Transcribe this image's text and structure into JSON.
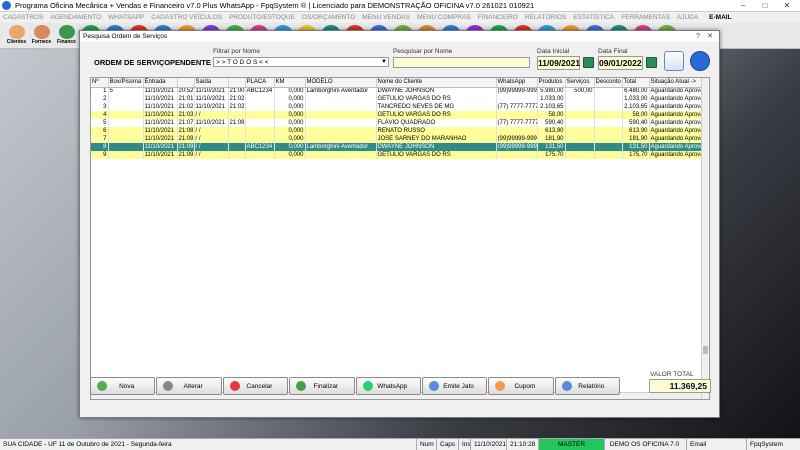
{
  "app": {
    "title": "Programa Oficina Mecânica + Vendas e Financeiro v7.0 Plus WhatsApp - FpqSystem ® | Licenciado para  DEMONSTRAÇÃO OFICINA v7.0 261021 010921"
  },
  "menu": [
    "CADASTROS",
    "AGENDAMENTO",
    "WHATSAPP",
    "CADASTRO VEÍCULOS",
    "PRODUTO/ESTOQUE",
    "OS/ORÇAMENTO",
    "MENU VENDAS",
    "MENU COMPRAS",
    "FINANCEIRO",
    "RELATÓRIOS",
    "ESTATÍSTICA",
    "FERRAMENTAS",
    "AJUDA"
  ],
  "menu_email": "E-MAIL",
  "toolbar": {
    "clientes": "Clientes",
    "fornecedores": "Fornece",
    "financeiro": "Finance"
  },
  "dialog": {
    "title": "Pesquisa Ordem de Serviços",
    "os_label": "ORDEM DE SERVIÇO",
    "status": "PENDENTE",
    "filter_label": "Filtrar por Nome",
    "filter_value": "> > T O D O S < <",
    "search_label": "Pesquisar por Nome",
    "search_value": "",
    "date_start_label": "Data Inicial",
    "date_start": "11/09/2021",
    "date_end_label": "Data Final",
    "date_end": "09/01/2022"
  },
  "table": {
    "headers": [
      "Nº",
      "Box/Pissma",
      "Entrada",
      "",
      "Saída",
      "",
      "PLACA",
      "KM",
      "MODELO",
      "Nome do Cliente",
      "WhatsApp",
      "Produtos",
      "Serviços",
      "Desconto",
      "Total",
      "Situação Atual ->"
    ],
    "rows": [
      {
        "style": "white",
        "cells": [
          "1",
          "5",
          "11/10/2021",
          "20:52",
          "11/10/2021",
          "21:00",
          "ABC1234",
          "0,000",
          "Lamborghini Aventador",
          "DWAYNE JOHNSON",
          "(99)99999-9999",
          "5.980,00",
          "500,00",
          "",
          "6.480,00",
          "Aguardando Aprovaç"
        ]
      },
      {
        "style": "white",
        "cells": [
          "2",
          "",
          "11/10/2021",
          "21:01",
          "11/10/2021",
          "21:02",
          "",
          "0,000",
          "",
          "GETULIO VARGAS DO RS",
          "",
          "1.033,00",
          "",
          "",
          "1.033,00",
          "Aguardando Aprovaç"
        ]
      },
      {
        "style": "white",
        "cells": [
          "3",
          "",
          "11/10/2021",
          "21:02",
          "11/10/2021",
          "21:02",
          "",
          "0,000",
          "",
          "TANCREDO NEVES DE MG",
          "(77) 7777-7777",
          "2.103,65",
          "",
          "",
          "2.103,65",
          "Aguardando Aprovaç"
        ]
      },
      {
        "style": "yellow",
        "cells": [
          "4",
          "",
          "11/10/2021",
          "21:03",
          "/  /",
          "",
          "",
          "0,000",
          "",
          "GETULIO VARGAS DO RS",
          "",
          "58,00",
          "",
          "",
          "58,00",
          "Aguardando Aprovaç"
        ]
      },
      {
        "style": "white",
        "cells": [
          "5",
          "",
          "11/10/2021",
          "21:07",
          "11/10/2021",
          "21:08",
          "",
          "0,000",
          "",
          "FLÁVIO QUADRADO",
          "(77) 7777-7777",
          "590,40",
          "",
          "",
          "590,40",
          "Aguardando Aprovaç"
        ]
      },
      {
        "style": "yellow",
        "cells": [
          "6",
          "",
          "11/10/2021",
          "21:08",
          "/  /",
          "",
          "",
          "0,000",
          "",
          "RENATO RUSSO",
          "",
          "613,90",
          "",
          "",
          "613,90",
          "Aguardando Aprovaç"
        ]
      },
      {
        "style": "yellow",
        "cells": [
          "7",
          "",
          "11/10/2021",
          "21:09",
          "/  /",
          "",
          "",
          "0,000",
          "",
          "JOSÉ SARNEY DO MARANHÃO",
          "(99)99999-9999",
          "181,90",
          "",
          "",
          "181,90",
          "Aguardando Aprovaç"
        ]
      },
      {
        "style": "sel",
        "cells": [
          "8",
          "",
          "11/10/2021",
          "21:09",
          "/  /",
          "",
          "ABC1234",
          "0,000",
          "Lamborghini Aventador",
          "DWAYNE JOHNSON",
          "(99)99999-9999",
          "131,50",
          "",
          "",
          "131,50",
          "Aguardando Aprovaç"
        ]
      },
      {
        "style": "yellow",
        "cells": [
          "9",
          "",
          "11/10/2021",
          "21:09",
          "/  /",
          "",
          "",
          "0,000",
          "",
          "GETULIO VARGAS DO RS",
          "",
          "175,70",
          "",
          "",
          "175,70",
          "Aguardando Aprovaç"
        ]
      }
    ]
  },
  "buttons": [
    {
      "label": "Nova",
      "name": "nova-button",
      "icon": "new-icon",
      "color": "#4caf50"
    },
    {
      "label": "Alterar",
      "name": "alterar-button",
      "icon": "edit-icon",
      "color": "#888888"
    },
    {
      "label": "Cancelar",
      "name": "cancelar-button",
      "icon": "cancel-icon",
      "color": "#e53935"
    },
    {
      "label": "Finalizar",
      "name": "finalizar-button",
      "icon": "finish-icon",
      "color": "#43a047"
    },
    {
      "label": "WhatsApp",
      "name": "whatsapp-button",
      "icon": "whatsapp-icon",
      "color": "#25d366"
    },
    {
      "label": "Emite Jato",
      "name": "emite-jato-button",
      "icon": "print-icon",
      "color": "#5b8bd6"
    },
    {
      "label": "Cupom",
      "name": "cupom-button",
      "icon": "coupon-icon",
      "color": "#f39c4a"
    },
    {
      "label": "Relatório",
      "name": "relatorio-button",
      "icon": "report-icon",
      "color": "#5b8bd6"
    }
  ],
  "total": {
    "label": "VALOR TOTAL",
    "value": "11.369,25"
  },
  "statusbar": {
    "city": "SUA CIDADE - UF 11 de Outubro de 2021 - Segunda-feira",
    "num": "Num",
    "caps": "Caps",
    "ins": "Ins",
    "date": "11/10/2021",
    "time": "21:10:28",
    "master": "MASTER",
    "oficina": "DEMO OS OFICINA 7.0",
    "email": "Email",
    "brand": "FpqSystem"
  }
}
